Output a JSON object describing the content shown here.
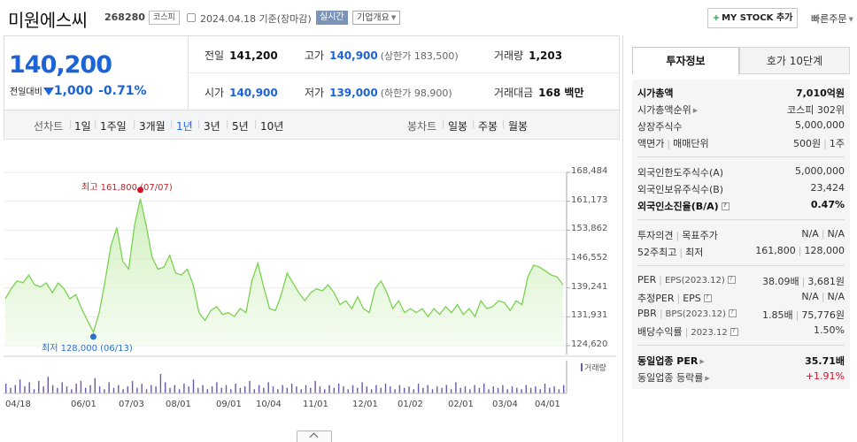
{
  "header": {
    "name": "미원에스씨",
    "code": "268280",
    "market": "코스피",
    "date": "2024.04.18 기준(장마감)",
    "realtime": "실시간",
    "company_btn": "기업개요",
    "mystock_btn": "MY STOCK 추가",
    "quick_order": "빠른주문"
  },
  "price": {
    "current": "140,200",
    "change_label": "전일대비",
    "change": "1,000",
    "change_pct": "-0.71%",
    "direction": "down"
  },
  "quote": {
    "prev_label": "전일",
    "prev": "141,200",
    "high_label": "고가",
    "high": "140,900",
    "upper_limit": "(상한가 183,500)",
    "volume_label": "거래량",
    "volume": "1,203",
    "open_label": "시가",
    "open": "140,900",
    "low_label": "저가",
    "low": "139,000",
    "lower_limit": "(하한가 98,900)",
    "amount_label": "거래대금",
    "amount": "168 백만"
  },
  "periods": {
    "line_label": "선차트",
    "line": [
      "1일",
      "1주일",
      "3개월",
      "1년",
      "3년",
      "5년",
      "10년"
    ],
    "line_selected": "1년",
    "candle_label": "봉차트",
    "candle": [
      "일봉",
      "주봉",
      "월봉"
    ]
  },
  "annotations": {
    "high": "최고 161,800 (07/07)",
    "low": "최저 128,000 (06/13)",
    "volume": "거래량"
  },
  "colors": {
    "price_down": "#1c63d8",
    "price_up": "#d0112b",
    "line": "#7ad14f",
    "volume": "#6a58a8"
  },
  "chart_data": {
    "type": "area",
    "y_ticks": [
      "168,484",
      "161,173",
      "153,862",
      "146,552",
      "139,241",
      "131,931",
      "124,620"
    ],
    "ylim": [
      124620,
      168484
    ],
    "x_ticks": [
      "04/18",
      "06/01",
      "07/03",
      "08/01",
      "09/01",
      "10/04",
      "11/01",
      "12/01",
      "01/02",
      "02/01",
      "03/04",
      "04/01"
    ],
    "series": [
      {
        "values": [
          136500,
          139000,
          141000,
          140500,
          142500,
          140000,
          139500,
          140500,
          138000,
          140500,
          139000,
          136500,
          137500,
          134000,
          131000,
          128000,
          133000,
          141000,
          150000,
          154500,
          146000,
          144000,
          155000,
          161800,
          155000,
          147000,
          144000,
          144500,
          147500,
          143000,
          142500,
          144000,
          140000,
          133000,
          131000,
          133500,
          134500,
          132500,
          133000,
          132000,
          134000,
          133000,
          141000,
          145500,
          139500,
          134000,
          133500,
          137500,
          143000,
          140500,
          138000,
          136000,
          138000,
          139000,
          138500,
          140000,
          138000,
          135000,
          136000,
          134000,
          137000,
          134000,
          133000,
          139000,
          141000,
          138000,
          134000,
          136000,
          133000,
          134000,
          133000,
          134000,
          132000,
          134000,
          132500,
          134500,
          133000,
          135000,
          132500,
          134000,
          132000,
          136000,
          134000,
          134500,
          136000,
          135500,
          133500,
          136000,
          135000,
          142000,
          145000,
          144500,
          143500,
          142500,
          142000,
          140000
        ]
      }
    ],
    "volume": [
      7,
      4,
      6,
      10,
      5,
      8,
      3,
      9,
      5,
      12,
      6,
      4,
      8,
      5,
      3,
      7,
      9,
      4,
      6,
      11,
      5,
      3,
      8,
      4,
      6,
      3,
      5,
      9,
      4,
      7,
      3,
      6,
      5,
      14,
      8,
      4,
      6,
      3,
      7,
      5,
      10,
      4,
      6,
      3,
      5,
      8,
      4,
      6,
      3,
      7,
      4,
      5,
      9,
      3,
      6,
      4,
      8,
      5,
      3,
      6,
      4,
      7,
      5,
      3,
      6,
      4,
      9,
      5,
      3,
      6,
      4,
      7,
      5,
      3,
      6,
      4,
      8,
      5,
      3,
      6,
      4,
      7,
      5,
      3,
      6,
      4,
      5,
      3,
      7,
      4,
      6,
      3,
      5,
      4,
      6,
      3,
      8,
      4,
      5,
      3,
      6,
      4,
      7,
      3,
      5,
      4,
      6,
      3,
      5,
      4,
      3,
      6,
      4,
      5,
      3,
      7,
      4,
      5,
      3,
      6
    ]
  },
  "tabs": [
    "투자정보",
    "호가 10단계"
  ],
  "invest": {
    "market_cap_label": "시가총액",
    "market_cap": "7,010억원",
    "rank_label": "시가총액순위",
    "rank": "코스피 302위",
    "shares_label": "상장주식수",
    "shares": "5,000,000",
    "par_label": "액면가",
    "unit_label": "매매단위",
    "par": "500원",
    "unit": "1주",
    "foreign_limit_label": "외국인한도주식수(A)",
    "foreign_limit": "5,000,000",
    "foreign_hold_label": "외국인보유주식수(B)",
    "foreign_hold": "23,424",
    "foreign_ratio_label": "외국인소진율(B/A)",
    "foreign_ratio": "0.47%",
    "opinion_label": "투자의견",
    "target_label": "목표주가",
    "opinion": "N/A",
    "target": "N/A",
    "w52_label": "52주최고",
    "w52_low_label": "최저",
    "w52_high": "161,800",
    "w52_low": "128,000",
    "per_label": "PER",
    "eps_label": "EPS(2023.12)",
    "per": "38.09배",
    "eps": "3,681원",
    "est_per_label": "추정PER",
    "est_eps_label": "EPS",
    "est_per": "N/A",
    "est_eps": "N/A",
    "pbr_label": "PBR",
    "bps_label": "BPS(2023.12)",
    "pbr": "1.85배",
    "bps": "75,776원",
    "div_label": "배당수익률",
    "div_date": "2023.12",
    "div": "1.50%",
    "sector_per_label": "동일업종 PER",
    "sector_per": "35.71배",
    "sector_chg_label": "동일업종 등락률",
    "sector_chg": "+1.91%"
  }
}
